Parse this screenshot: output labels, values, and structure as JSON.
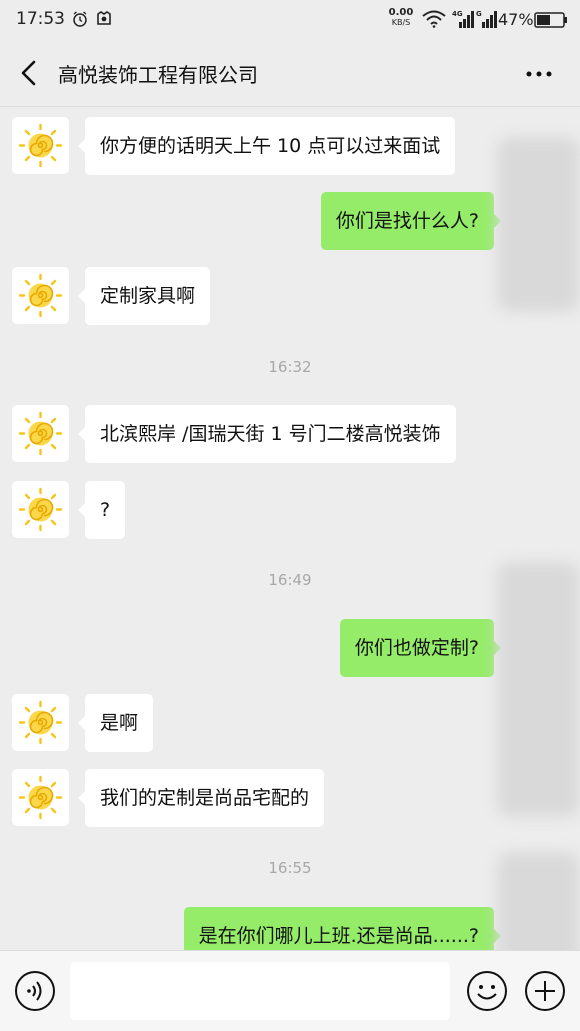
{
  "status_bar": {
    "time": "17:53",
    "net_speed_value": "0.00",
    "net_speed_unit": "KB/S",
    "signal1_label": "4G",
    "signal2_label": "G",
    "battery_pct": "47%"
  },
  "header": {
    "title": "高悦装饰工程有限公司"
  },
  "messages": [
    {
      "side": "in",
      "text": "你方便的话明天上午 10 点可以过来面试"
    },
    {
      "side": "out",
      "text": "你们是找什么人?"
    },
    {
      "side": "in",
      "text": "定制家具啊"
    },
    {
      "timestamp": "16:32"
    },
    {
      "side": "in",
      "text": "北滨熙岸 /国瑞天街 1 号门二楼高悦装饰"
    },
    {
      "side": "in",
      "text": "?"
    },
    {
      "timestamp": "16:49"
    },
    {
      "side": "out",
      "text": "你们也做定制?"
    },
    {
      "side": "in",
      "text": "是啊"
    },
    {
      "side": "in",
      "text": "我们的定制是尚品宅配的"
    },
    {
      "timestamp": "16:55"
    },
    {
      "side": "out",
      "text": "是在你们哪儿上班.还是尚品......?"
    }
  ],
  "colors": {
    "background": "#ededed",
    "incoming_bubble": "#ffffff",
    "outgoing_bubble": "#95ec69",
    "timestamp_text": "#a8a8a8",
    "avatar_sun": "#f5c518"
  },
  "icons": {
    "back": "chevron-left-icon",
    "more": "more-dots-icon",
    "avatar": "sun-icon",
    "voice": "voice-icon",
    "emoji": "smiley-icon",
    "plus": "plus-icon"
  }
}
